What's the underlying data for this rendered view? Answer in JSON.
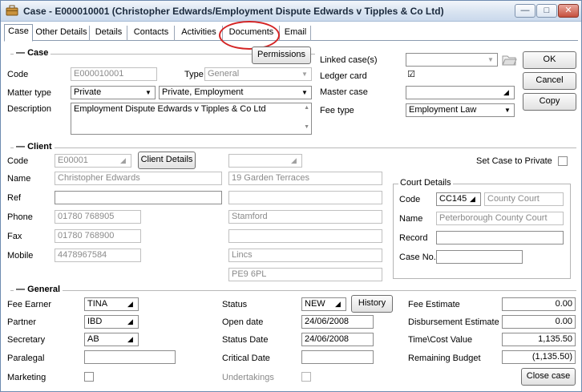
{
  "window": {
    "title": "Case - E000010001 (Christopher Edwards/Employment Dispute Edwards v Tipples & Co Ltd)",
    "controls": {
      "minimize": "—",
      "maximize": "□",
      "close": "✕"
    }
  },
  "tabs": [
    "Case",
    "Other Details",
    "Details",
    "Contacts",
    "Activities",
    "Documents",
    "Email"
  ],
  "case": {
    "section_title": "Case",
    "permissions_label": "Permissions",
    "code_label": "Code",
    "code_value": "E000010001",
    "type_label": "Type",
    "type_value": "General",
    "matter_type_label": "Matter type",
    "matter_type_value": "Private",
    "matter_subtype_value": "Private, Employment",
    "description_label": "Description",
    "description_value": "Employment Dispute Edwards v Tipples & Co Ltd",
    "linked_cases_label": "Linked case(s)",
    "ledger_card_label": "Ledger card",
    "ledger_card_checked": true,
    "master_case_label": "Master case",
    "fee_type_label": "Fee type",
    "fee_type_value": "Employment Law",
    "ok_label": "OK",
    "cancel_label": "Cancel",
    "copy_label": "Copy"
  },
  "client": {
    "section_title": "Client",
    "code_label": "Code",
    "code_value": "E00001",
    "client_details_label": "Client Details",
    "name_label": "Name",
    "name_value": "Christopher Edwards",
    "ref_label": "Ref",
    "ref_value": "",
    "phone_label": "Phone",
    "phone_value": "01780 768905",
    "fax_label": "Fax",
    "fax_value": "01780 768900",
    "mobile_label": "Mobile",
    "mobile_value": "4478967584",
    "address": [
      "19 Garden Terraces",
      "",
      "Stamford",
      "",
      "Lincs",
      "PE9 6PL"
    ],
    "set_private_label": "Set Case to Private",
    "set_private_checked": false
  },
  "court": {
    "group_title": "Court Details",
    "code_label": "Code",
    "code_value": "CC145",
    "code_desc": "County Court",
    "name_label": "Name",
    "name_value": "Peterborough County Court",
    "record_label": "Record",
    "record_value": "",
    "case_no_label": "Case No.",
    "case_no_value": ""
  },
  "general": {
    "section_title": "General",
    "fee_earner_label": "Fee Earner",
    "fee_earner_value": "TINA",
    "partner_label": "Partner",
    "partner_value": "IBD",
    "secretary_label": "Secretary",
    "secretary_value": "AB",
    "paralegal_label": "Paralegal",
    "paralegal_value": "",
    "marketing_label": "Marketing",
    "status_label": "Status",
    "status_value": "NEW",
    "history_label": "History",
    "open_date_label": "Open date",
    "open_date_value": "24/06/2008",
    "status_date_label": "Status Date",
    "status_date_value": "24/06/2008",
    "critical_date_label": "Critical Date",
    "critical_date_value": "",
    "undertakings_label": "Undertakings",
    "fee_estimate_label": "Fee Estimate",
    "fee_estimate_value": "0.00",
    "disbursement_label": "Disbursement Estimate",
    "disbursement_value": "0.00",
    "time_cost_label": "Time\\Cost Value",
    "time_cost_value": "1,135.50",
    "remaining_label": "Remaining Budget",
    "remaining_value": "(1,135.50)",
    "close_case_label": "Close case"
  },
  "colors": {
    "highlight_ring": "#d42424",
    "titlebar": "#d9e4f1"
  }
}
